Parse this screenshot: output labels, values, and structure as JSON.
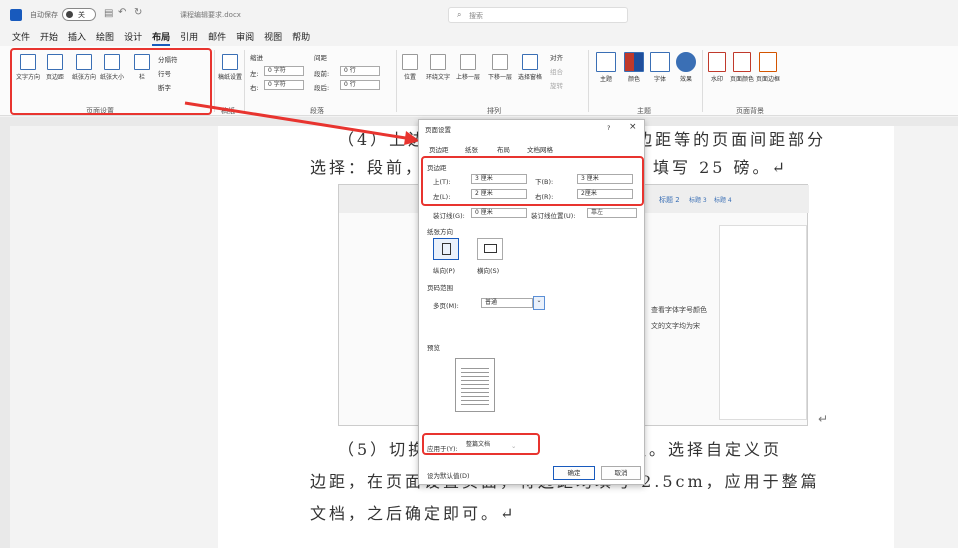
{
  "titlebar": {
    "autosave": "自动保存",
    "toggle": "关",
    "filename": "课程编辑要求.docx",
    "search_placeholder": "搜索"
  },
  "menu": [
    "文件",
    "开始",
    "插入",
    "绘图",
    "设计",
    "布局",
    "引用",
    "邮件",
    "审阅",
    "视图",
    "帮助"
  ],
  "ribbon": {
    "page_setup": {
      "label": "页面设置",
      "text_direction": "文字方向",
      "margins": "页边距",
      "orientation": "纸张方向",
      "size": "纸张大小",
      "columns": "栏",
      "breaks": "分隔符",
      "line_numbers": "行号",
      "hyphenation": "断字"
    },
    "draft": {
      "label": "稿纸",
      "btn": "稿纸设置"
    },
    "paragraph": {
      "label": "段落",
      "indent": "缩进",
      "spacing": "间距",
      "left": "左:",
      "right": "右:",
      "before": "段前:",
      "after": "段后:",
      "indent_left_val": "0 字符",
      "indent_right_val": "0 字符",
      "before_val": "0 行",
      "after_val": "0 行"
    },
    "arrange": {
      "label": "排列",
      "position": "位置",
      "wrap": "环绕文字",
      "forward": "上移一层",
      "backward": "下移一层",
      "pane": "选择窗格",
      "align": "对齐",
      "group": "组合",
      "rotate": "旋转"
    },
    "theme": {
      "label": "主题",
      "theme": "主题",
      "colors": "颜色",
      "fonts": "字体",
      "effects": "效果"
    },
    "page_bg": {
      "label": "页面背景",
      "watermark": "水印",
      "page_color": "页面颜色",
      "page_borders": "页面边框"
    }
  },
  "document": {
    "line1": "（4）上边距，下边距，左边距，右边距等的页面间距部分",
    "line2a": "选择：段前，",
    "line2b": "填写 25 磅。↵",
    "line3a": "（5）切换",
    "line3b": "钮。选择自定义页",
    "line4": "边距，在页面设置页面，将边距均填写 2.5cm，应用于整篇",
    "line5": "文档，之后确定即可。↵",
    "img_text1": "查看字体字号颜色",
    "img_text2": "文的文字均为宋",
    "img_style1": "标题 2",
    "img_style2": "标题 3",
    "img_style3": "标题 4"
  },
  "dialog": {
    "title": "页面设置",
    "help": "?",
    "close": "×",
    "tabs": [
      "页边距",
      "纸张",
      "布局",
      "文档网格"
    ],
    "margins_section": "页边距",
    "top_label": "上(T):",
    "top_val": "3 厘米",
    "bottom_label": "下(B):",
    "bottom_val": "3 厘米",
    "left_label": "左(L):",
    "left_val": "2 厘米",
    "right_label": "右(R):",
    "right_val": "2厘米",
    "gutter_label": "装订线(G):",
    "gutter_val": "0 厘米",
    "gutter_pos_label": "装订线位置(U):",
    "gutter_pos_val": "靠左",
    "orientation_section": "纸张方向",
    "portrait": "纵向(P)",
    "landscape": "横向(S)",
    "pages_section": "页码范围",
    "multiple_label": "多页(M):",
    "multiple_val": "普通",
    "preview_section": "预览",
    "apply_label": "应用于(Y):",
    "apply_val": "整篇文档",
    "default_btn": "设为默认值(D)",
    "ok": "确定",
    "cancel": "取消"
  },
  "colors": {
    "accent": "#185abd",
    "highlight": "#e8342f"
  }
}
